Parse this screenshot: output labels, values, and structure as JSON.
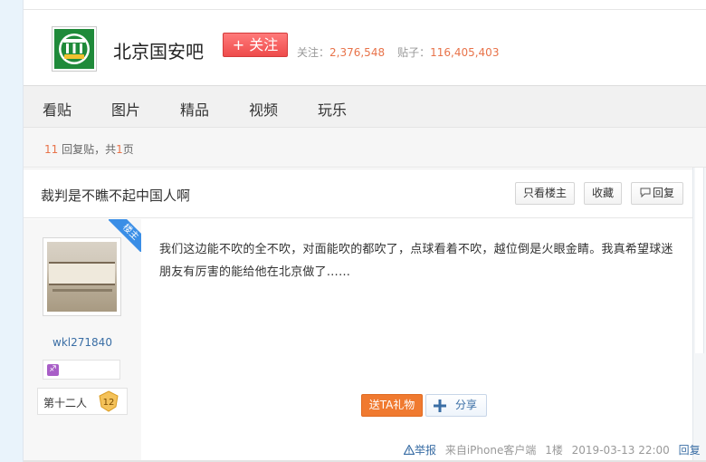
{
  "forum": {
    "name": "北京国安吧",
    "follow_label": "+ 关注",
    "followers_label": "关注：",
    "followers_value": "2,376,548",
    "posts_label": "贴子：",
    "posts_value": "116,405,403"
  },
  "nav": {
    "items": [
      "看贴",
      "图片",
      "精品",
      "视频",
      "玩乐"
    ]
  },
  "pager": {
    "count": "11",
    "text_mid": " 回复贴，共",
    "pages": "1",
    "text_end": "页"
  },
  "thread": {
    "title": "裁判是不瞧不起中国人啊",
    "only_op_label": "只看楼主",
    "favorite_label": "收藏",
    "reply_label": "回复"
  },
  "post": {
    "op_badge": "楼主",
    "username": "wkl271840",
    "level_name": "第十二人",
    "level_num": "12",
    "content": "我们这边能不吹的全不吹，对面能吹的都吹了，点球看着不吹，越位倒是火眼金睛。我真希望球迷朋友有厉害的能给他在北京做了……",
    "gift_label": "送TA礼物",
    "share_label": "分享",
    "report_label": "举报",
    "source": "来自iPhone客户端",
    "floor": "1楼",
    "time": "2019-03-13 22:00",
    "reply_link": "回复",
    "zodiac_icon": "sagittarius-icon"
  },
  "colors": {
    "accent_orange": "#e8734a",
    "follow_red": "#ee4b4b",
    "link_blue": "#3a6ea5",
    "op_badge_blue": "#3a8ee6"
  }
}
